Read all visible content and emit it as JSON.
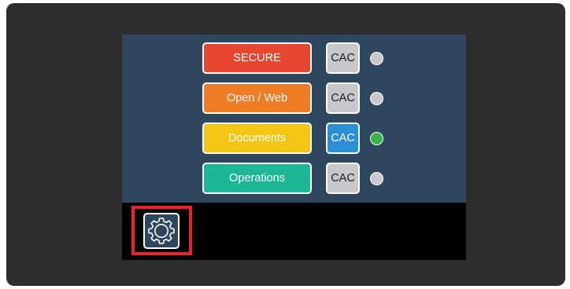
{
  "networks": [
    {
      "label": "SECURE",
      "color": "#e8472f",
      "cac_label": "CAC",
      "cac_active": false,
      "cac_color": "#c8c8cc",
      "status": "inactive",
      "led_color": "#c8c8cc"
    },
    {
      "label": "Open / Web",
      "color": "#ee7d26",
      "cac_label": "CAC",
      "cac_active": false,
      "cac_color": "#c8c8cc",
      "status": "inactive",
      "led_color": "#c8c8cc"
    },
    {
      "label": "Documents",
      "color": "#f4c515",
      "cac_label": "CAC",
      "cac_active": true,
      "cac_color": "#2b8fd3",
      "status": "active",
      "led_color": "#3cb34a"
    },
    {
      "label": "Operations",
      "color": "#1cb796",
      "cac_label": "CAC",
      "cac_active": false,
      "cac_color": "#c8c8cc",
      "status": "inactive",
      "led_color": "#c8c8cc"
    }
  ],
  "settings": {
    "icon": "gear-icon",
    "highlighted": true,
    "highlight_color": "#e8242b"
  },
  "colors": {
    "device_bezel": "#2d2d2d",
    "panel_bg": "#2e475e",
    "toolbar_bg": "#000000"
  }
}
